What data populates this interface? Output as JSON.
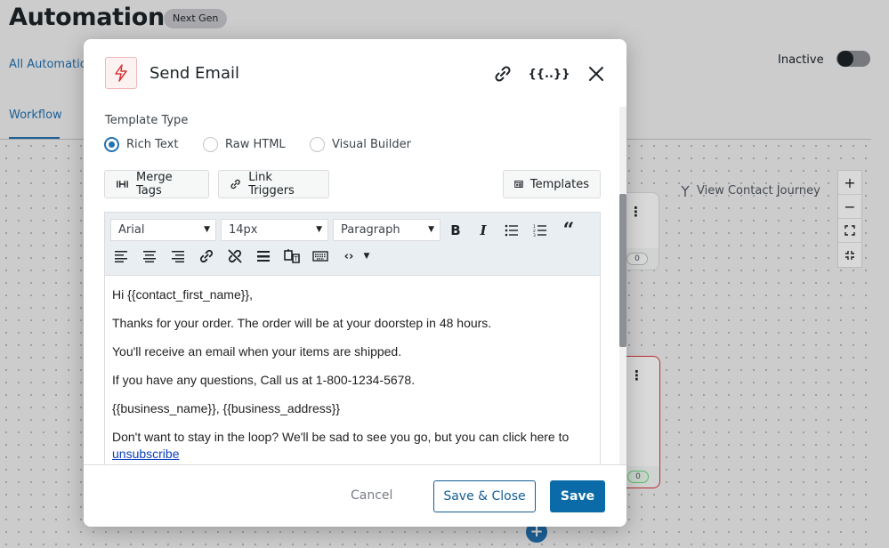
{
  "page": {
    "title": "Automations",
    "badge": "Next Gen",
    "all_link": "All Automation",
    "status_label": "Inactive",
    "tab_workflow": "Workflow",
    "journey_label": "View Contact Journey",
    "node1_count": "0",
    "node2_count": "0"
  },
  "modal": {
    "title": "Send Email",
    "merge_icon_text": "{{..}}",
    "template_type_label": "Template Type",
    "radios": [
      {
        "label": "Rich Text",
        "selected": true
      },
      {
        "label": "Raw HTML",
        "selected": false
      },
      {
        "label": "Visual Builder",
        "selected": false
      }
    ],
    "buttons": {
      "merge_tags": "Merge Tags",
      "link_triggers": "Link Triggers",
      "templates": "Templates"
    },
    "editor": {
      "font": "Arial",
      "size": "14px",
      "block": "Paragraph",
      "lines": [
        "Hi {{contact_first_name}},",
        "Thanks for your order. The order will be at your doorstep in 48 hours.",
        "You'll receive an email when your items are shipped.",
        "If you have any questions, Call us at 1-800-1234-5678.",
        "{{business_name}}, {{business_address}}",
        "Don't want to stay in the loop? We'll be sad to see you go, but you can click here to"
      ],
      "unsubscribe_link": "unsubscribe"
    },
    "footer": {
      "cancel": "Cancel",
      "save_close": "Save & Close",
      "save": "Save"
    }
  },
  "colors": {
    "primary": "#2271b1",
    "save_button": "#0b6ba8",
    "action_icon": "#d63638"
  }
}
